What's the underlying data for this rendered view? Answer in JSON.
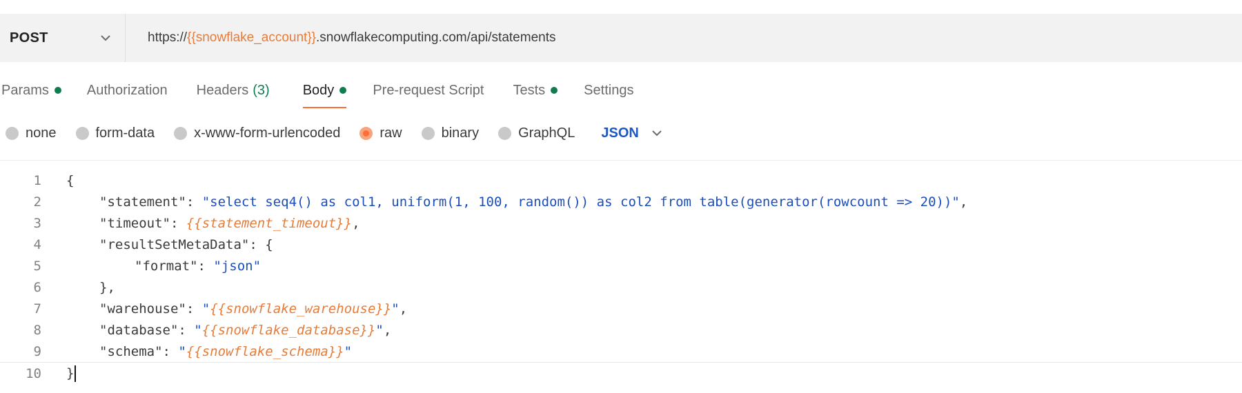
{
  "request": {
    "method": "POST",
    "url_prefix": "https://",
    "url_variable": "{{snowflake_account}}",
    "url_suffix": ".snowflakecomputing.com/api/statements"
  },
  "tabs": [
    {
      "label": "Params",
      "dot": true
    },
    {
      "label": "Authorization"
    },
    {
      "label": "Headers",
      "count": "(3)"
    },
    {
      "label": "Body",
      "dot": true,
      "active": true
    },
    {
      "label": "Pre-request Script"
    },
    {
      "label": "Tests",
      "dot": true
    },
    {
      "label": "Settings"
    }
  ],
  "body_types": {
    "options": [
      "none",
      "form-data",
      "x-www-form-urlencoded",
      "raw",
      "binary",
      "GraphQL"
    ],
    "selected": "raw",
    "format": "JSON"
  },
  "editor": {
    "line_numbers": [
      "1",
      "2",
      "3",
      "4",
      "5",
      "6",
      "7",
      "8",
      "9",
      "10"
    ],
    "lines": {
      "l1": "{",
      "l2_key": "\"statement\"",
      "l2_sep": ": ",
      "l2_val": "\"select seq4() as col1, uniform(1, 100, random()) as col2 from table(generator(rowcount => 20))\"",
      "l2_end": ",",
      "l3_key": "\"timeout\"",
      "l3_sep": ": ",
      "l3_var": "{{statement_timeout}}",
      "l3_end": ",",
      "l4_key": "\"resultSetMetaData\"",
      "l4_end": ": {",
      "l5_key": "\"format\"",
      "l5_sep": ": ",
      "l5_val": "\"json\"",
      "l6": "},",
      "l7_key": "\"warehouse\"",
      "l7_sep": ": ",
      "l7_q1": "\"",
      "l7_var": "{{snowflake_warehouse}}",
      "l7_q2": "\"",
      "l7_end": ",",
      "l8_key": "\"database\"",
      "l8_sep": ": ",
      "l8_q1": "\"",
      "l8_var": "{{snowflake_database}}",
      "l8_q2": "\"",
      "l8_end": ",",
      "l9_key": "\"schema\"",
      "l9_sep": ": ",
      "l9_q1": "\"",
      "l9_var": "{{snowflake_schema}}",
      "l9_q2": "\"",
      "l10": "}"
    }
  },
  "colors": {
    "accent": "#ff6c37",
    "variable": "#e57c3a",
    "string": "#1b4dbc",
    "status_dot": "#0f7d4f",
    "format_link": "#1d56c5"
  }
}
